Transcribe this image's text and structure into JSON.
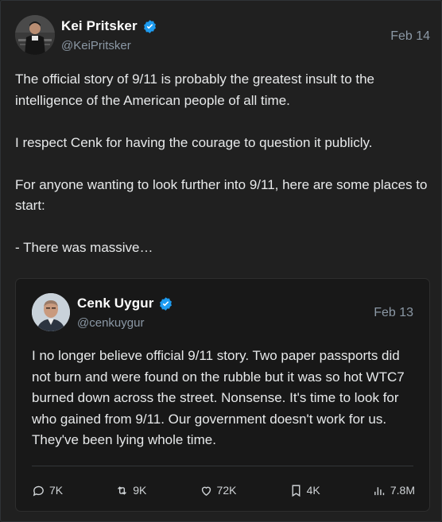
{
  "tweet": {
    "author_name": "Kei Pritsker",
    "author_handle": "@KeiPritsker",
    "date": "Feb 14",
    "paragraphs": [
      "The official story of 9/11 is probably the greatest insult to the intelligence of the American people of all time.",
      "I respect Cenk for having the courage to question it publicly.",
      "For anyone wanting to look further into 9/11, here are some places to start:",
      "- There was massive…"
    ]
  },
  "quoted": {
    "author_name": "Cenk Uygur",
    "author_handle": "@cenkuygur",
    "date": "Feb 13",
    "text": "I no longer believe official 9/11 story. Two paper passports did not burn and were found on the rubble but it was so hot WTC7 burned down across the street. Nonsense. It's time to look for who gained from 9/11. Our government doesn't work for us. They've been lying whole time."
  },
  "actions": {
    "replies": "7K",
    "reposts": "9K",
    "likes": "72K",
    "bookmarks": "4K",
    "views": "7.8M"
  },
  "colors": {
    "verified_badge": "#1d9bf0",
    "background": "#202020",
    "quote_background": "#181818",
    "muted_text": "#8b98a5"
  },
  "icons": [
    "verified-badge-icon",
    "reply-icon",
    "repost-icon",
    "like-icon",
    "bookmark-icon",
    "views-icon"
  ]
}
